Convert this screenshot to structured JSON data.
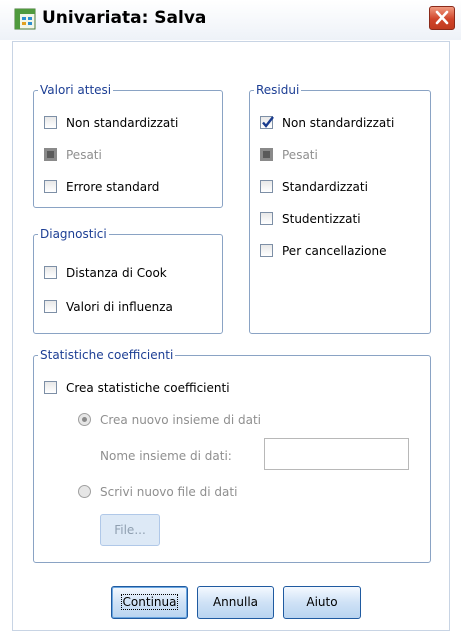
{
  "dialog": {
    "title": "Univariata: Salva"
  },
  "valori_attesi": {
    "legend": "Valori attesi",
    "items": [
      {
        "label": "Non standardizzati",
        "checked": false,
        "enabled": true
      },
      {
        "label": "Pesati",
        "checked": false,
        "enabled": false
      },
      {
        "label": "Errore standard",
        "checked": false,
        "enabled": true
      }
    ]
  },
  "residui": {
    "legend": "Residui",
    "items": [
      {
        "label": "Non standardizzati",
        "checked": true,
        "enabled": true
      },
      {
        "label": "Pesati",
        "checked": false,
        "enabled": false
      },
      {
        "label": "Standardizzati",
        "checked": false,
        "enabled": true
      },
      {
        "label": "Studentizzati",
        "checked": false,
        "enabled": true
      },
      {
        "label": "Per cancellazione",
        "checked": false,
        "enabled": true
      }
    ]
  },
  "diagnostici": {
    "legend": "Diagnostici",
    "items": [
      {
        "label": "Distanza di Cook",
        "checked": false,
        "enabled": true
      },
      {
        "label": "Valori di influenza",
        "checked": false,
        "enabled": true
      }
    ]
  },
  "statistiche": {
    "legend": "Statistiche coefficienti",
    "crea_label": "Crea statistiche coefficienti",
    "crea_checked": false,
    "radio_nuovo": {
      "label": "Crea nuovo insieme di dati",
      "selected": true,
      "enabled": false
    },
    "nome_label": "Nome insieme di dati:",
    "nome_value": "",
    "radio_file": {
      "label": "Scrivi nuovo file di dati",
      "selected": false,
      "enabled": false
    },
    "file_button": "File..."
  },
  "buttons": {
    "continua": "Continua",
    "annulla": "Annulla",
    "aiuto": "Aiuto"
  },
  "colors": {
    "group_border": "#8aa3c4",
    "legend_text": "#1c3e94",
    "check_mark": "#1a3c8e",
    "close_button": "#d0452a"
  }
}
